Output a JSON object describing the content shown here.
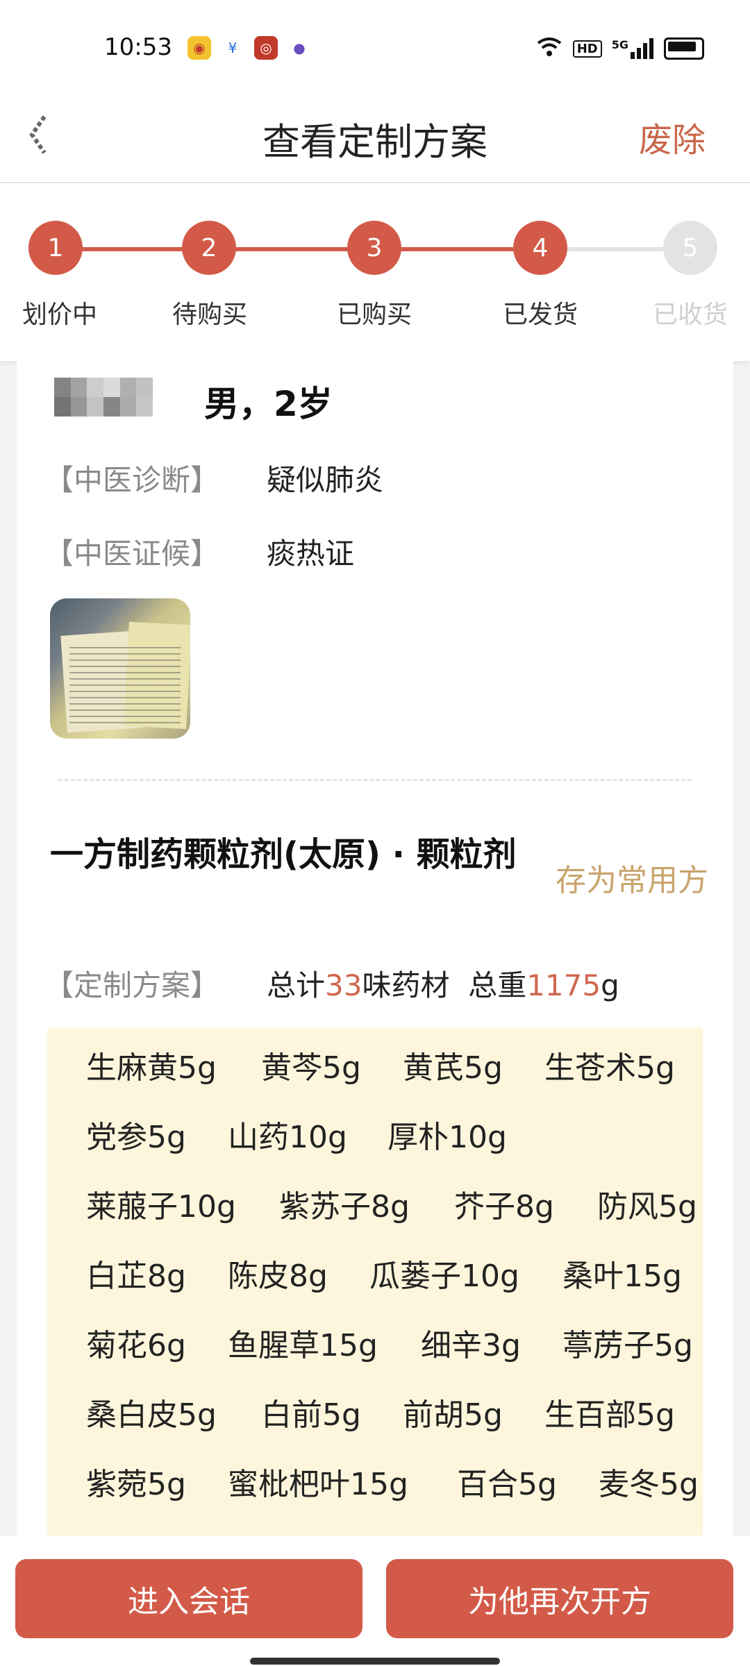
{
  "status_bar": {
    "time": "10:53",
    "hd": "HD",
    "network": "5G"
  },
  "header": {
    "title": "查看定制方案",
    "action": "废除"
  },
  "stepper": {
    "steps": [
      {
        "num": "1",
        "label": "划价中",
        "done": true
      },
      {
        "num": "2",
        "label": "待购买",
        "done": true
      },
      {
        "num": "3",
        "label": "已购买",
        "done": true
      },
      {
        "num": "4",
        "label": "已发货",
        "done": true
      },
      {
        "num": "5",
        "label": "已收货",
        "done": false
      }
    ]
  },
  "patient": {
    "info": "男，2岁",
    "diagnosis_label": "【中医诊断】",
    "diagnosis_value": "疑似肺炎",
    "syndrome_label": "【中医证候】",
    "syndrome_value": "痰热证"
  },
  "prescription": {
    "pharmacy": "一方制药颗粒剂(太原) · 颗粒剂",
    "save_label": "存为常用方",
    "plan_label": "【定制方案】",
    "total_prefix": "总计",
    "herb_count": "33",
    "herb_suffix": "味药材",
    "weight_prefix": "总重",
    "total_weight": "1175",
    "weight_unit": "g",
    "herbs": [
      [
        "生麻黄5g",
        "黄芩5g",
        "黄芪5g",
        "生苍术5g"
      ],
      [
        "党参5g",
        "山药10g",
        "厚朴10g"
      ],
      [
        "莱菔子10g",
        "紫苏子8g",
        "芥子8g",
        "防风5g"
      ],
      [
        "白芷8g",
        "陈皮8g",
        "瓜蒌子10g",
        "桑叶15g"
      ],
      [
        "菊花6g",
        "鱼腥草15g",
        "细辛3g",
        "葶苈子5g"
      ],
      [
        "桑白皮5g",
        "白前5g",
        "前胡5g",
        "生百部5g"
      ],
      [
        "紫菀5g",
        "蜜枇杷叶15g",
        "百合5g",
        "麦冬5g"
      ]
    ]
  },
  "bottom": {
    "chat_button": "进入会话",
    "represcribe_button": "为他再次开方"
  }
}
